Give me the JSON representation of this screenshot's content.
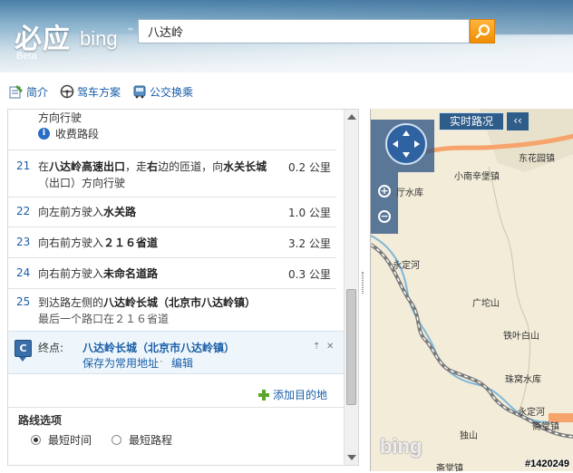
{
  "header": {
    "logo_cn": "必应",
    "logo_en": "bing",
    "logo_tm": "™",
    "logo_beta": "Beta",
    "search_value": "八达岭"
  },
  "toolbar": {
    "summary_label": "简介",
    "drive_label": "驾车方案",
    "transit_label": "公交换乘"
  },
  "route": {
    "prev_text": "方向行驶",
    "toll_label": "收费路段",
    "steps": [
      {
        "num": "21",
        "pre": "在",
        "b1": "八达岭高速出口",
        "mid1": "，走",
        "b2": "右",
        "mid2": "边的匝道，向",
        "b3": "水关长城",
        "post": "（出口）方向行驶",
        "dist": "0.2 公里"
      },
      {
        "num": "22",
        "pre": "向左前方驶入",
        "b1": "水关路",
        "dist": "1.0 公里"
      },
      {
        "num": "23",
        "pre": "向右前方驶入",
        "b1": "２１６省道",
        "dist": "3.2 公里"
      },
      {
        "num": "24",
        "pre": "向右前方驶入",
        "b1": "未命名道路",
        "dist": "0.3 公里"
      },
      {
        "num": "25",
        "pre": "到达路左侧的",
        "b1": "八达岭长城（北京市八达岭镇）",
        "line2": "最后一个路口在２１６省道"
      }
    ]
  },
  "destination": {
    "pin_letter": "C",
    "label": "终点:",
    "name": "八达岭长城（北京市八达岭镇）",
    "save_label": "保存为常用地址",
    "separator": "·",
    "edit_label": "编辑",
    "up_glyph": "⇡",
    "close_glyph": "✕"
  },
  "add_destination": "添加目的地",
  "route_options": {
    "title": "路线选项",
    "shortest_time": "最短时间",
    "shortest_distance": "最短路程",
    "selected": "shortest_time"
  },
  "map": {
    "traffic_label": "实时路况",
    "collapse_glyph": "‹‹",
    "zoom_in": "+",
    "zoom_out": "−",
    "bing_watermark": "bing",
    "labels": {
      "donghuayuan": "东花园镇",
      "xiaonanxinpu": "小南辛堡镇",
      "reservoir1": "厅水库",
      "yongdinghe": "永定河",
      "guangtuoshan": "广坨山",
      "tieyebaishan": "铁叶白山",
      "zhuwoshuiku": "珠窝水库",
      "yongdinghe2": "永定河",
      "zhanjiuzhen": "斋堂镇",
      "dushan": "独山",
      "zhaitang": "斋堂镇"
    },
    "colors": {
      "highway": "#f6a46b",
      "railway": "#7a7a7a",
      "river": "#7fb7d9",
      "land": "#f2ecd9"
    }
  },
  "image_id_watermark": "#1420249"
}
